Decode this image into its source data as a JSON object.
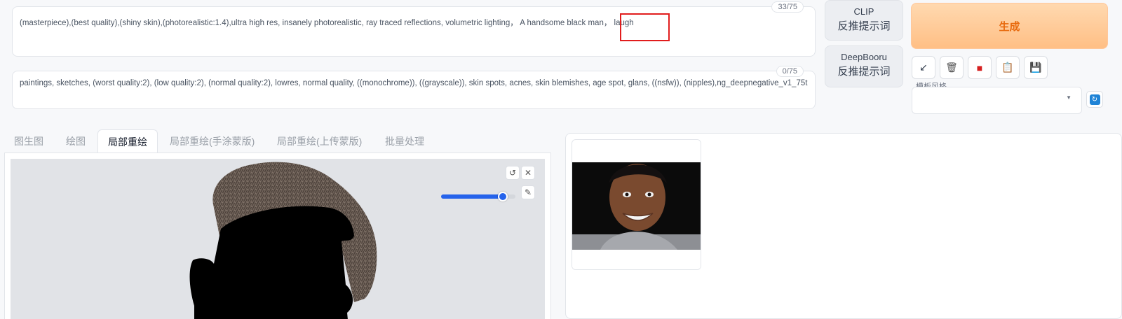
{
  "positive_prompt": {
    "text": "(masterpiece),(best quality),(shiny skin),(photorealistic:1.4),ultra high res,  insanely photorealistic, ray traced reflections, volumetric lighting，  A handsome black man，  laugh",
    "counter": "33/75"
  },
  "negative_prompt": {
    "text": "paintings, sketches, (worst quality:2), (low quality:2), (normal quality:2), lowres, normal quality, ((monochrome)), ((grayscale)), skin spots, acnes, skin blemishes, age spot, glans, ((nsfw)), (nipples),ng_deepnegative_v1_75t",
    "counter": "0/75"
  },
  "interrogate": {
    "clip_title": "CLIP",
    "clip_subtitle": "反推提示词",
    "deepbooru_title": "DeepBooru",
    "deepbooru_subtitle": "反推提示词"
  },
  "generate_label": "生成",
  "toolbar": {
    "icons": [
      "arrow-icon",
      "trash-icon",
      "red-card-icon",
      "clipboard-icon",
      "save-icon"
    ],
    "arrow_glyph": "↙",
    "trash_glyph": "🗑",
    "red_glyph": "■",
    "clip_glyph": "📋",
    "save_glyph": "💾"
  },
  "style": {
    "label": "模板风格",
    "caret": "▼",
    "refresh_glyph": "↻"
  },
  "tabs": [
    "图生图",
    "绘图",
    "局部重绘",
    "局部重绘(手涂蒙版)",
    "局部重绘(上传蒙版)",
    "批量处理"
  ],
  "active_tab_index": 2,
  "canvas": {
    "undo_glyph": "↺",
    "close_glyph": "✕",
    "brush_glyph": "✎",
    "brush_size_fraction": 0.83
  },
  "colors": {
    "accent": "#2563eb",
    "generate_text": "#e8690c",
    "highlight": "#e11d1d"
  }
}
